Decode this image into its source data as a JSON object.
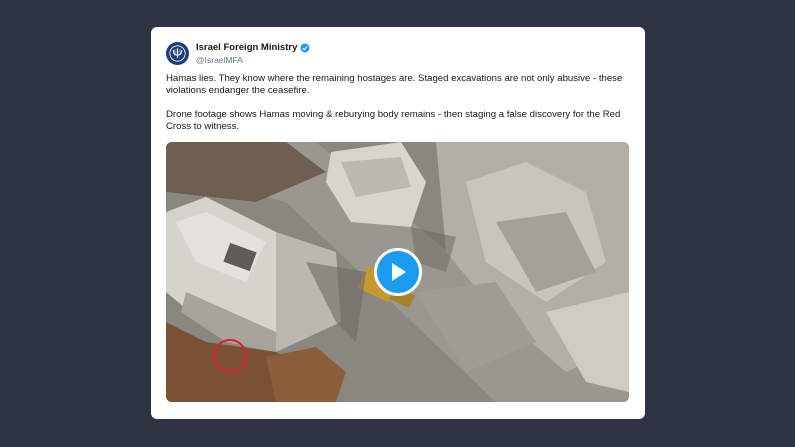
{
  "tweet": {
    "author": {
      "display_name": "Israel Foreign Ministry",
      "handle": "@IsraelMFA",
      "verified": true,
      "avatar_icon": "israel-emblem-icon"
    },
    "paragraphs": [
      "Hamas lies. They know where the remaining hostages are. Staged excavations are not only abusive - these violations endanger the ceasefire.",
      "Drone footage shows Hamas moving & reburying body remains - then staging a false discovery for the Red Cross to witness."
    ],
    "media": {
      "type": "video",
      "play_icon": "play-icon",
      "annotation": "red-circle-highlight"
    }
  },
  "colors": {
    "background": "#2e3444",
    "card": "#ffffff",
    "accent": "#1d9bf0",
    "verified_badge": "#1d9bf0",
    "highlight": "#e0202a"
  }
}
